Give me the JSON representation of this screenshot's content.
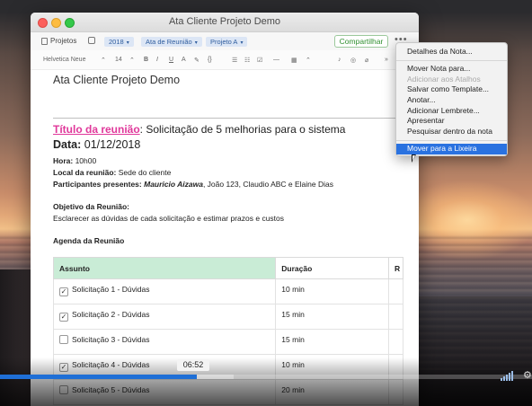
{
  "window": {
    "title": "Ata Cliente Projeto Demo"
  },
  "toolbar": {
    "notebook_label": "Projetos",
    "tags": [
      {
        "label": "2018"
      },
      {
        "label": "Ata de Reunião"
      },
      {
        "label": "Projeto A"
      }
    ],
    "share_label": "Compartilhar",
    "more_label": "•••"
  },
  "format_bar": {
    "font_name": "Helvetica Neue",
    "font_size": "14",
    "bold": "B",
    "italic": "I",
    "underline": "U",
    "code": "{}"
  },
  "note": {
    "title": "Ata Cliente Projeto Demo",
    "meeting_title_label": "Título da reunião",
    "meeting_title_value": ": Solicitação de 5 melhorias para o sistema",
    "date_label": "Data:",
    "date_value": "01/12/2018",
    "time_label": "Hora:",
    "time_value": "10h00",
    "location_label": "Local da reunião:",
    "location_value": "Sede do cliente",
    "participants_label": "Participantes presentes:",
    "participants_bold": "Mauricio Aizawa",
    "participants_rest": ", João 123, Claudio ABC e Elaine Dias",
    "objective_label": "Objetivo da Reunião:",
    "objective_text": "Esclarecer as dúvidas de cada solicitação e estimar prazos e custos",
    "agenda_label": "Agenda da Reunião"
  },
  "agenda_table": {
    "headers": [
      "Assunto",
      "Duração",
      "R"
    ],
    "rows": [
      {
        "checked": true,
        "subject": "Solicitação 1 - Dúvidas",
        "duration": "10 min"
      },
      {
        "checked": true,
        "subject": "Solicitação 2 - Dúvidas",
        "duration": "15 min"
      },
      {
        "checked": false,
        "subject": "Solicitação 3 - Dúvidas",
        "duration": "15 min"
      },
      {
        "checked": true,
        "subject": "Solicitação 4 - Dúvidas",
        "duration": "10 min"
      },
      {
        "checked": false,
        "subject": "Solicitação 5 - Dúvidas",
        "duration": "20 min"
      }
    ]
  },
  "context_menu": {
    "items": [
      {
        "label": "Detalhes da Nota...",
        "state": "normal"
      },
      {
        "label": "Mover Nota para...",
        "state": "normal"
      },
      {
        "label": "Adicionar aos Atalhos",
        "state": "disabled"
      },
      {
        "label": "Salvar como Template...",
        "state": "normal"
      },
      {
        "label": "Anotar...",
        "state": "normal"
      },
      {
        "label": "Adicionar Lembrete...",
        "state": "normal"
      },
      {
        "label": "Apresentar",
        "state": "normal"
      },
      {
        "label": "Pesquisar dentro da nota",
        "state": "normal"
      },
      {
        "label": "Mover para a Lixeira",
        "state": "selected"
      }
    ]
  },
  "player": {
    "hover_time": "06:52",
    "progress_fraction": 0.37,
    "accent_color": "#1f6fd6"
  }
}
